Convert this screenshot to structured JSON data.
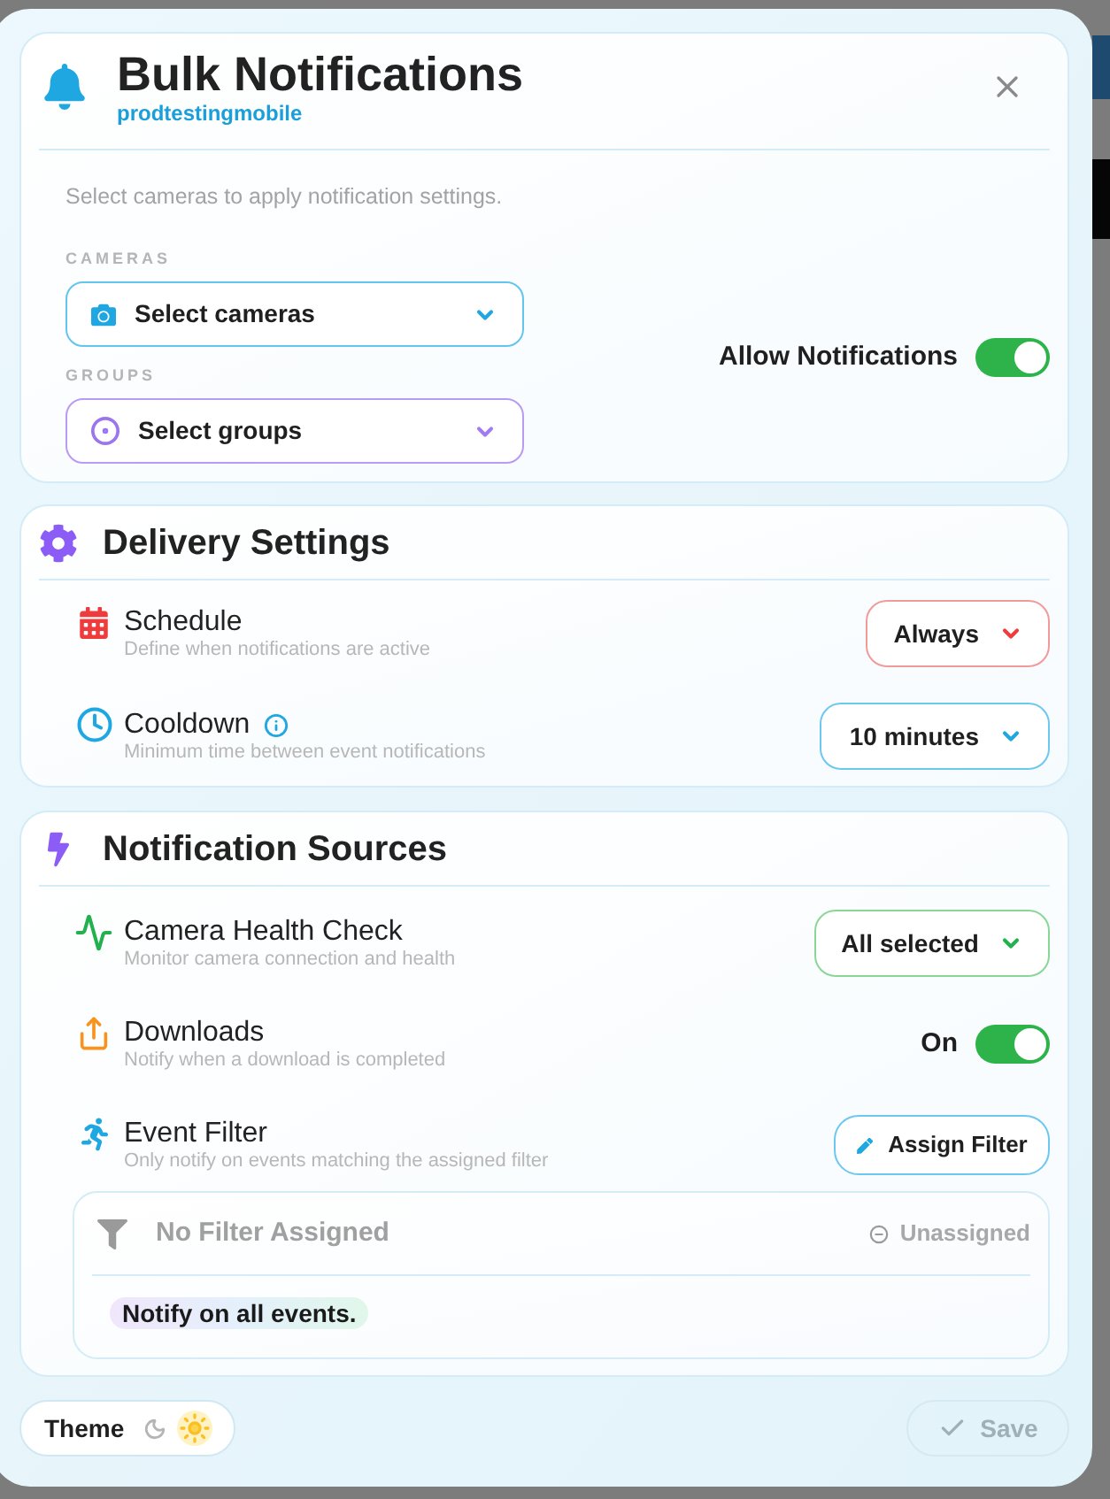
{
  "dialog": {
    "title": "Bulk Notifications",
    "subtitle": "prodtestingmobile"
  },
  "camera_selection": {
    "hint": "Select cameras to apply notification settings.",
    "fields": [
      {
        "kind": "cameras",
        "label": "CAMERAS",
        "placeholder": "Select cameras"
      },
      {
        "kind": "groups",
        "label": "GROUPS",
        "placeholder": "Select groups"
      }
    ]
  },
  "allow_notifications": {
    "label": "Allow Notifications",
    "on": true
  },
  "delivery_settings": {
    "title": "Delivery Settings",
    "rows": [
      {
        "kind": "schedule",
        "title": "Schedule",
        "description": "Define when notifications are active",
        "value": "Always",
        "info": false
      },
      {
        "kind": "cooldown",
        "title": "Cooldown",
        "description": "Minimum time between event notifications",
        "value": "10 minutes",
        "info": true
      }
    ]
  },
  "notification_sources": {
    "title": "Notification Sources",
    "rows": [
      {
        "kind": "health_check",
        "title": "Camera Health Check",
        "description": "Monitor camera connection and health",
        "value": "All selected"
      },
      {
        "kind": "downloads",
        "title": "Downloads",
        "description": "Notify when a download is completed",
        "value": "On",
        "on": true
      },
      {
        "kind": "event_filter",
        "title": "Event Filter",
        "description": "Only notify on events matching the assigned filter",
        "button": "Assign Filter",
        "filter": {
          "title": "No Filter Assigned",
          "status": "Unassigned",
          "note": "Notify on all events."
        }
      }
    ]
  },
  "footer": {
    "theme": {
      "label": "Theme",
      "light": true
    },
    "save": {
      "label": "Save",
      "disabled": true
    }
  }
}
